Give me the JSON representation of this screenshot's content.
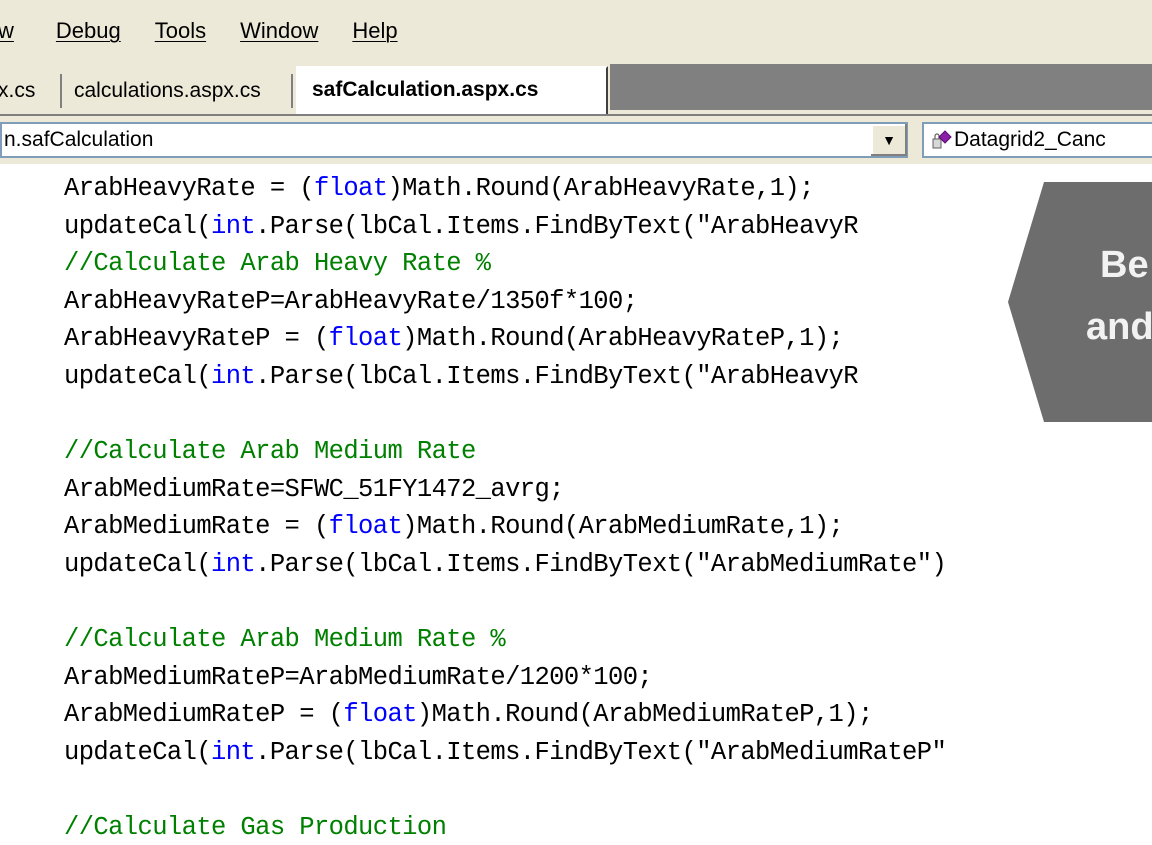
{
  "menu": {
    "items": [
      "w",
      "Debug",
      "Tools",
      "Window",
      "Help"
    ]
  },
  "tabs": {
    "items": [
      "x.cs",
      "calculations.aspx.cs",
      "safCalculation.aspx.cs"
    ],
    "active": "safCalculation.aspx.cs"
  },
  "navbar": {
    "class_combo": "n.safCalculation",
    "member_combo": "Datagrid2_Canc"
  },
  "code": {
    "lines": [
      {
        "pre": "ArabHeavyRate = (",
        "kw": "float",
        "post": ")Math.Round(ArabHeavyRate,1);"
      },
      {
        "pre": "updateCal(",
        "kw": "int",
        "post": ".Parse(lbCal.Items.FindByText(\"ArabHeavyR"
      },
      {
        "comment": "//Calculate Arab Heavy Rate %"
      },
      {
        "pre": "ArabHeavyRateP=ArabHeavyRate/1350f*100;"
      },
      {
        "pre": "ArabHeavyRateP = (",
        "kw": "float",
        "post": ")Math.Round(ArabHeavyRateP,1);"
      },
      {
        "pre": "updateCal(",
        "kw": "int",
        "post": ".Parse(lbCal.Items.FindByText(\"ArabHeavyR"
      },
      {
        "pre": ""
      },
      {
        "comment": "//Calculate Arab Medium Rate"
      },
      {
        "pre": "ArabMediumRate=SFWC_51FY1472_avrg;"
      },
      {
        "pre": "ArabMediumRate = (",
        "kw": "float",
        "post": ")Math.Round(ArabMediumRate,1);"
      },
      {
        "pre": "updateCal(",
        "kw": "int",
        "post": ".Parse(lbCal.Items.FindByText(\"ArabMediumRate\")"
      },
      {
        "pre": ""
      },
      {
        "comment": "//Calculate Arab Medium Rate %"
      },
      {
        "pre": "ArabMediumRateP=ArabMediumRate/1200*100;"
      },
      {
        "pre": "ArabMediumRateP = (",
        "kw": "float",
        "post": ")Math.Round(ArabMediumRateP,1);"
      },
      {
        "pre": "updateCal(",
        "kw": "int",
        "post": ".Parse(lbCal.Items.FindByText(\"ArabMediumRateP\""
      },
      {
        "pre": ""
      },
      {
        "comment": "//Calculate Gas Production"
      }
    ]
  },
  "callout": {
    "line1": "Be",
    "line2": "and"
  },
  "colors": {
    "keyword": "#0000ff",
    "comment": "#008000",
    "chrome": "#ece9d8",
    "callout": "#6d6d6d"
  }
}
